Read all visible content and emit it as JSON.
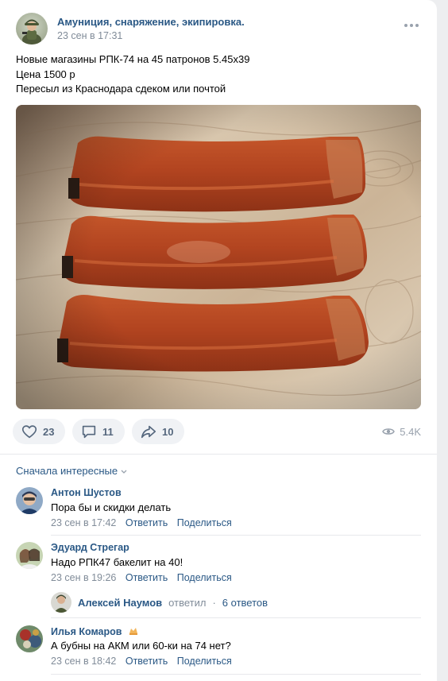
{
  "post": {
    "group_name": "Амуниция, снаряжение, экипировка.",
    "time": "23 сен в 17:31",
    "text_lines": [
      "Новые магазины РПК-74 на 45 патронов 5.45х39",
      "Цена 1500 р",
      "Пересыл из Краснодара сдеком или почтой"
    ],
    "likes": "23",
    "comments": "11",
    "shares": "10",
    "views": "5.4K"
  },
  "sort_label": "Сначала интересные",
  "comments": [
    {
      "author": "Антон Шустов",
      "text": "Пора бы и скидки делать",
      "time": "23 сен в 17:42",
      "reply": "Ответить",
      "share": "Поделиться"
    },
    {
      "author": "Эдуард Стрегар",
      "text": "Надо РПК47 бакелит на 40!",
      "time": "23 сен в 19:26",
      "reply": "Ответить",
      "share": "Поделиться"
    },
    {
      "author": "Илья Комаров",
      "text": "А бубны на АКМ или 60-ки на 74 нет?",
      "time": "23 сен в 18:42",
      "reply": "Ответить",
      "share": "Поделиться"
    }
  ],
  "thread": {
    "author": "Алексей Наумов",
    "verb": "ответил",
    "dot": "·",
    "count": "6 ответов"
  },
  "colors": {
    "link": "#2a5885",
    "secondary": "#818c99",
    "button_bg": "#f0f2f5",
    "magazine": "#b84a24"
  },
  "icons": {
    "more": "more-dots-icon",
    "like": "heart-icon",
    "comment": "comment-bubble-icon",
    "share": "share-arrow-icon",
    "views": "eye-icon",
    "sort": "chevron-down-icon",
    "badge": "donut-badge-icon"
  }
}
